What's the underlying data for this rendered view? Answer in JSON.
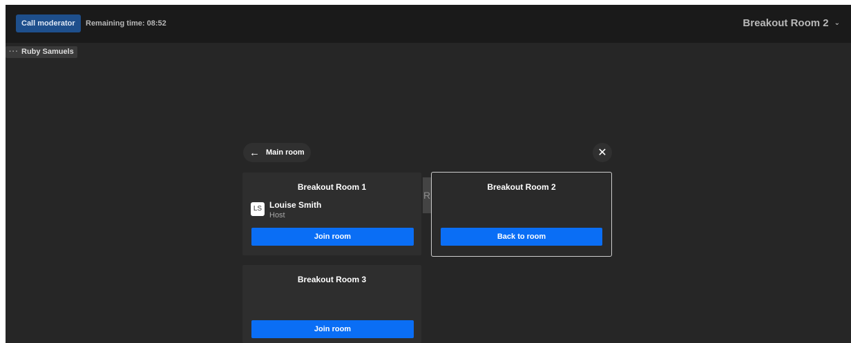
{
  "topbar": {
    "call_moderator_label": "Call moderator",
    "remaining_time": "Remaining time: 08:52",
    "current_room": "Breakout Room 2"
  },
  "participant_tag": {
    "name": "Ruby Samuels"
  },
  "panel": {
    "back_label": "Main room",
    "ghost_text": "RS",
    "rooms": [
      {
        "title": "Breakout Room 1",
        "participants": [
          {
            "initials": "LS",
            "name": "Louise Smith",
            "role": "Host"
          }
        ],
        "button_label": "Join room"
      },
      {
        "title": "Breakout Room 2",
        "button_label": "Back to room",
        "current": true
      },
      {
        "title": "Breakout Room 3",
        "button_label": "Join room"
      }
    ]
  },
  "colors": {
    "accent": "#0a6ef5",
    "moderator_button": "#1e4f8c",
    "background": "#262626",
    "topbar": "#1a1a1a"
  },
  "icons": {
    "back": "arrow-left-icon",
    "close": "close-icon",
    "dropdown": "chevron-down-icon",
    "menu": "more-dots-icon"
  }
}
